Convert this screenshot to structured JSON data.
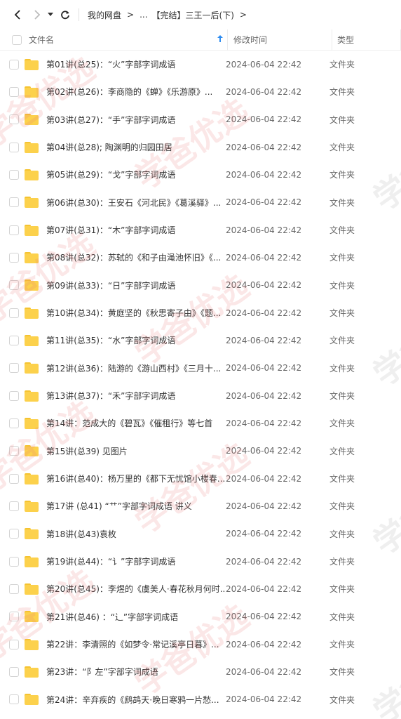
{
  "breadcrumb": {
    "root": "我的网盘",
    "ellipsis": "...",
    "current": "【完结】三王一后(下)"
  },
  "header": {
    "name": "文件名",
    "date": "修改时间",
    "type": "类型"
  },
  "files": [
    {
      "name": "第01讲(总25)：“火”字部字词成语",
      "date": "2024-06-04 22:42",
      "type": "文件夹"
    },
    {
      "name": "第02讲(总26)：李商隐的《蝉》《乐游原》...",
      "date": "2024-06-04 22:42",
      "type": "文件夹"
    },
    {
      "name": "第03讲(总27)：“手”字部字词成语",
      "date": "2024-06-04 22:42",
      "type": "文件夹"
    },
    {
      "name": "第04讲(总28); 陶渊明的归园田居",
      "date": "2024-06-04 22:42",
      "type": "文件夹"
    },
    {
      "name": "第05讲(总29)：“戈”字部字词成语",
      "date": "2024-06-04 22:42",
      "type": "文件夹"
    },
    {
      "name": "第06讲(总30)：王安石《河北民》《葛溪驿》...",
      "date": "2024-06-04 22:42",
      "type": "文件夹"
    },
    {
      "name": "第07讲(总31)：“木”字部字词成语",
      "date": "2024-06-04 22:42",
      "type": "文件夹"
    },
    {
      "name": "第08讲(总32)：苏轼的《和子由渑池怀旧》《...",
      "date": "2024-06-04 22:42",
      "type": "文件夹"
    },
    {
      "name": "第09讲(总33)：“日”字部字词成语",
      "date": "2024-06-04 22:42",
      "type": "文件夹"
    },
    {
      "name": "第10讲(总34)：黄庭坚的《秋思寄子由》《题...",
      "date": "2024-06-04 22:42",
      "type": "文件夹"
    },
    {
      "name": "第11讲(总35)：“水”字部字词成语",
      "date": "2024-06-04 22:42",
      "type": "文件夹"
    },
    {
      "name": "第12讲(总36)：陆游的《游山西村》《三月十...",
      "date": "2024-06-04 22:42",
      "type": "文件夹"
    },
    {
      "name": "第13讲(总37)：“禾”字部字词成语",
      "date": "2024-06-04 22:42",
      "type": "文件夹"
    },
    {
      "name": "第14讲：范成大的《碧瓦》《催租行》等七首",
      "date": "2024-06-04 22:42",
      "type": "文件夹"
    },
    {
      "name": "第15讲(总39) 见图片",
      "date": "2024-06-04 22:42",
      "type": "文件夹"
    },
    {
      "name": "第16讲(总40)：杨万里的《都下无忧馆小楼春...",
      "date": "2024-06-04 22:42",
      "type": "文件夹"
    },
    {
      "name": "第17讲 (总41) “艹”字部字词成语 讲义",
      "date": "2024-06-04 22:42",
      "type": "文件夹"
    },
    {
      "name": "第18讲(总43)袁枚",
      "date": "2024-06-04 22:42",
      "type": "文件夹"
    },
    {
      "name": "第19讲(总44)：“讠”字部字词成语",
      "date": "2024-06-04 22:42",
      "type": "文件夹"
    },
    {
      "name": "第20讲(总45)：李煜的《虞美人·春花秋月何时...",
      "date": "2024-06-04 22:42",
      "type": "文件夹"
    },
    {
      "name": "第21讲(总46) ：“辶”字部字词成语",
      "date": "2024-06-04 22:42",
      "type": "文件夹"
    },
    {
      "name": "第22讲：李清照的《如梦令·常记溪亭日暮》...",
      "date": "2024-06-04 22:42",
      "type": "文件夹"
    },
    {
      "name": "第23讲：“阝左”字部字词成语",
      "date": "2024-06-04 22:42",
      "type": "文件夹"
    },
    {
      "name": "第24讲：辛弃疾的《鹧鸪天·晚日寒鸦一片愁...",
      "date": "2024-06-04 22:42",
      "type": "文件夹"
    }
  ],
  "watermark": {
    "text": "学爸优选"
  },
  "icons": {
    "back": "chevron-left-icon",
    "forward": "chevron-right-icon",
    "dropdown": "caret-down-icon",
    "refresh": "refresh-icon",
    "sort": "arrow-up-icon",
    "folder": "folder-icon"
  },
  "colors": {
    "folder": "#fcd14c",
    "accent": "#2d8cf0"
  }
}
